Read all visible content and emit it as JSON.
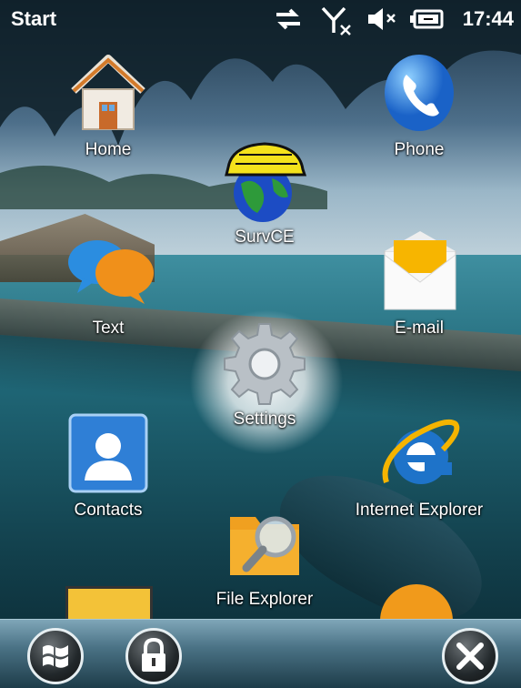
{
  "status": {
    "title": "Start",
    "time": "17:44",
    "icons": [
      "connectivity-icon",
      "no-signal-icon",
      "volume-muted-icon",
      "battery-charging-icon"
    ]
  },
  "tiles": [
    {
      "label": "Home",
      "icon": "home-icon"
    },
    {
      "label": "Phone",
      "icon": "phone-icon"
    },
    {
      "label": "SurvCE",
      "icon": "survce-icon"
    },
    {
      "label": "Text",
      "icon": "text-bubbles-icon"
    },
    {
      "label": "E-mail",
      "icon": "email-envelope-icon"
    },
    {
      "label": "Settings",
      "icon": "settings-gear-icon",
      "selected": true
    },
    {
      "label": "Contacts",
      "icon": "contacts-icon"
    },
    {
      "label": "Internet Explorer",
      "icon": "internet-explorer-icon"
    },
    {
      "label": "File Explorer",
      "icon": "file-explorer-icon"
    }
  ],
  "taskbar": {
    "buttons": [
      "windows-start-icon",
      "lock-icon",
      "close-icon"
    ]
  },
  "colors": {
    "accent_blue": "#2f7fd6",
    "email_yellow": "#f7b500",
    "text_white": "#ffffff"
  }
}
